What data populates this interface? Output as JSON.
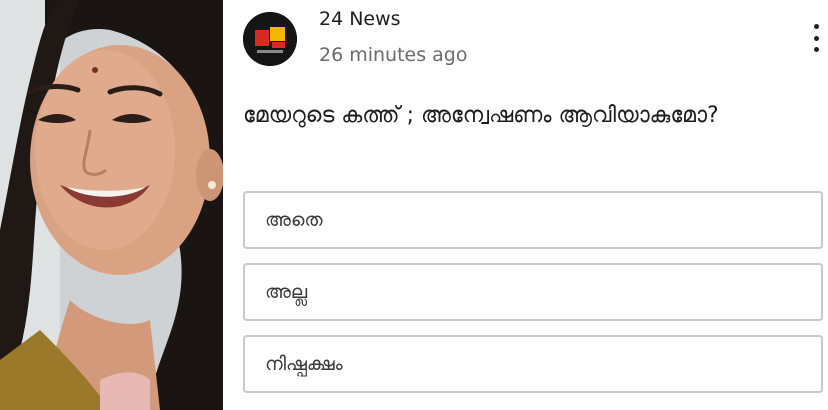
{
  "post": {
    "source_name": "24 News",
    "timestamp": "26 minutes ago",
    "question": "മേയറുടെ കത്ത് ; അന്വേഷണം ആവിയാകുമോ?",
    "options": [
      {
        "label": "അതെ"
      },
      {
        "label": "അല്ല"
      },
      {
        "label": "നിഷ്പക്ഷം"
      }
    ]
  },
  "icons": {
    "more": "more-vertical-icon",
    "avatar": "channel-logo"
  },
  "colors": {
    "option_border": "#c9c9c9",
    "text_primary": "#1c1c1c",
    "text_secondary": "#6b6b6b",
    "logo_red": "#d62b1f",
    "logo_gold": "#f2b705"
  }
}
